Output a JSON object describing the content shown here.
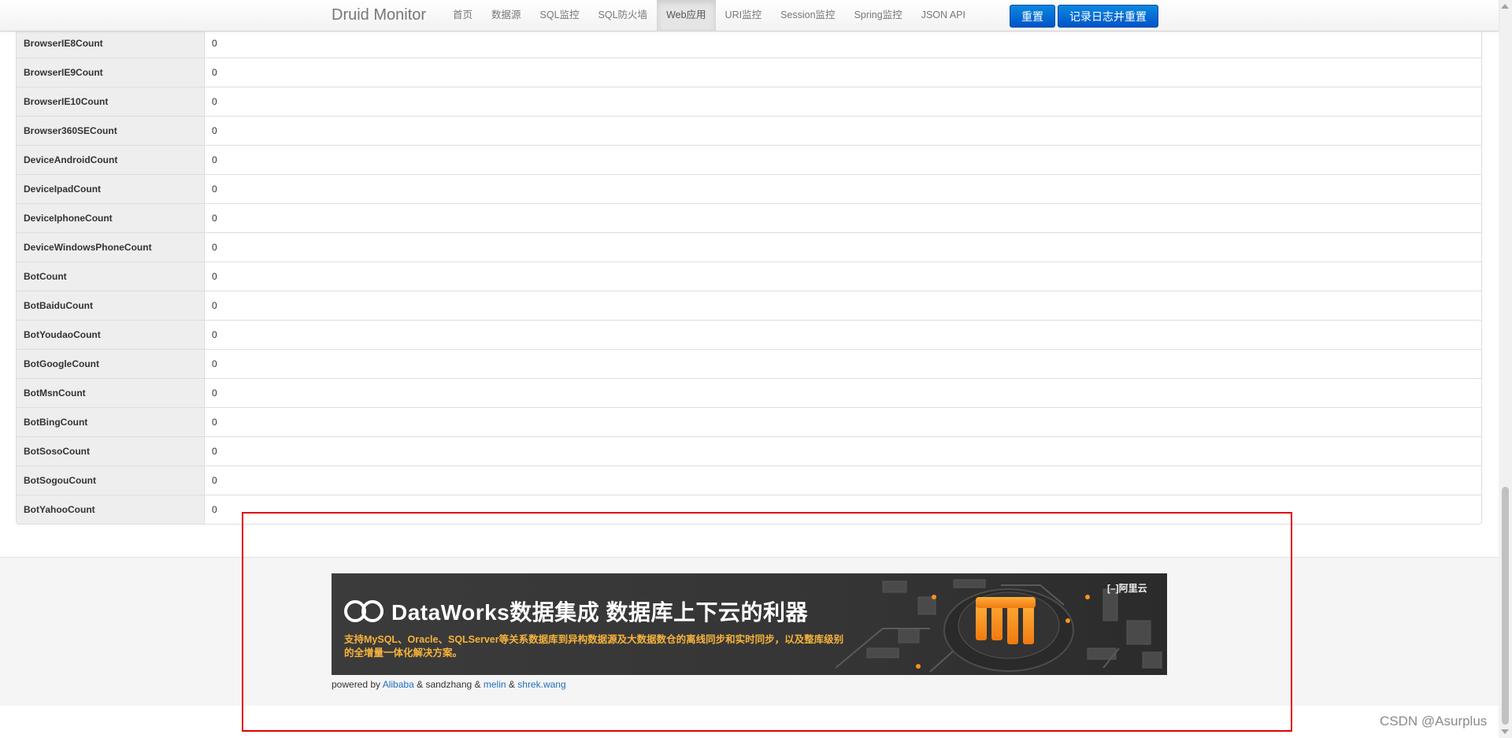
{
  "navbar": {
    "brand": "Druid Monitor",
    "items": [
      {
        "label": "首页"
      },
      {
        "label": "数据源"
      },
      {
        "label": "SQL监控"
      },
      {
        "label": "SQL防火墙"
      },
      {
        "label": "Web应用"
      },
      {
        "label": "URI监控"
      },
      {
        "label": "Session监控"
      },
      {
        "label": "Spring监控"
      },
      {
        "label": "JSON API"
      }
    ],
    "active": "Web应用",
    "reset_label": "重置",
    "log_reset_label": "记录日志并重置"
  },
  "table": {
    "rows": [
      {
        "key": "BrowserIE8Count",
        "value": "0"
      },
      {
        "key": "BrowserIE9Count",
        "value": "0"
      },
      {
        "key": "BrowserIE10Count",
        "value": "0"
      },
      {
        "key": "Browser360SECount",
        "value": "0"
      },
      {
        "key": "DeviceAndroidCount",
        "value": "0"
      },
      {
        "key": "DeviceIpadCount",
        "value": "0"
      },
      {
        "key": "DeviceIphoneCount",
        "value": "0"
      },
      {
        "key": "DeviceWindowsPhoneCount",
        "value": "0"
      },
      {
        "key": "BotCount",
        "value": "0"
      },
      {
        "key": "BotBaiduCount",
        "value": "0"
      },
      {
        "key": "BotYoudaoCount",
        "value": "0"
      },
      {
        "key": "BotGoogleCount",
        "value": "0"
      },
      {
        "key": "BotMsnCount",
        "value": "0"
      },
      {
        "key": "BotBingCount",
        "value": "0"
      },
      {
        "key": "BotSosoCount",
        "value": "0"
      },
      {
        "key": "BotSogouCount",
        "value": "0"
      },
      {
        "key": "BotYahooCount",
        "value": "0"
      }
    ]
  },
  "banner": {
    "title": "DataWorks数据集成 数据库上下云的利器",
    "subtitle": "支持MySQL、Oracle、SQLServer等关系数据库到异构数据源及大数据数仓的离线同步和实时同步，以及整库级别的全增量一体化解决方案。",
    "aliyun": "阿里云",
    "colors": {
      "background": "#3d3d3d",
      "accent": "#f7931e",
      "subtitle": "#f6b33b"
    }
  },
  "footer": {
    "powered_by": "powered by",
    "amp": "&",
    "link_alibaba": "Alibaba",
    "name_sandzhang": "sandzhang",
    "link_melin": "melin",
    "link_shrek": "shrek.wang"
  },
  "watermark": "CSDN @Asurplus"
}
